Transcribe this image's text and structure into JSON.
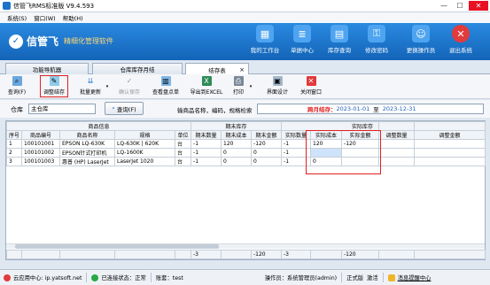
{
  "app": {
    "title": "信管飞RMS标准版 V9.4.593"
  },
  "window_controls": [
    "—",
    "☐",
    "✕"
  ],
  "menu": [
    "系统(S)",
    "窗口(W)",
    "帮助(H)"
  ],
  "brand": {
    "name": "信管飞",
    "slogan": "精细化管理软件"
  },
  "topnav": [
    {
      "label": "我的工作台",
      "color": "#4ea4f0",
      "glyph": "▦"
    },
    {
      "label": "单据中心",
      "color": "#4ea4f0",
      "glyph": "≣"
    },
    {
      "label": "库存查询",
      "color": "#4ea4f0",
      "glyph": "▤"
    },
    {
      "label": "修改密码",
      "color": "#4ea4f0",
      "glyph": "⚿"
    },
    {
      "label": "更换操作员",
      "color": "#4ea4f0",
      "glyph": "☺"
    },
    {
      "label": "退出系统",
      "color": "#e23b3b",
      "glyph": "✕"
    }
  ],
  "tabs": [
    "功能导航器",
    "仓库库存月结",
    "结存表"
  ],
  "tab_close": "×",
  "toolbar": {
    "query": "查询(F)",
    "adjust": "调整结存",
    "batch": "批量更新",
    "confirm": "确认保存",
    "check_slip": "查看盘点单",
    "export": "导出到EXCEL",
    "print": "打印",
    "design": "界面设计",
    "close": "关闭窗口"
  },
  "filter": {
    "warehouse_label": "仓库",
    "warehouse_value": "主仓库",
    "query_btn": "查询(F)",
    "search_placeholder": "输商品名称，编码，规格检索",
    "period_label": "跨月结存：",
    "period_from": "2023-01-01",
    "period_to_word": "至",
    "period_to": "2023-12-31"
  },
  "grid": {
    "group_headers": {
      "product": "商品信息",
      "period_end": "期末库存",
      "actual": "实际库存"
    },
    "columns": [
      "序号",
      "商品编号",
      "商品名称",
      "规格",
      "单位",
      "期末数量",
      "期末成本",
      "期末金额",
      "实际数量",
      "实际成本",
      "实际金额",
      "调整数量",
      "调整金额"
    ],
    "rows": [
      [
        "1",
        "100101001",
        "EPSON LQ-630K",
        "LQ-630K | 620K",
        "台",
        "-1",
        "120",
        "-120",
        "-1",
        "120",
        "-120",
        "",
        ""
      ],
      [
        "2",
        "100101002",
        "EPSON针式打印机",
        "LQ-1600K",
        "台",
        "-1",
        "0",
        "0",
        "-1",
        "",
        "",
        "",
        ""
      ],
      [
        "3",
        "100101003",
        "惠普 (HP) LaserJet",
        "LaserJet 1020",
        "台",
        "-1",
        "0",
        "0",
        "-1",
        "0",
        "",
        "",
        ""
      ]
    ],
    "totals": [
      "",
      "",
      "",
      "",
      "",
      "-3",
      "",
      "-120",
      "-3",
      "",
      "-120",
      "",
      ""
    ]
  },
  "status": {
    "cloud": "云应用中心: ip.yatsoft.net",
    "connect": "已连接状态：正常",
    "account": "账套：test",
    "operator": "操作员：系统管理员(admin)",
    "version": "正式版",
    "activate": "激活",
    "message": "消息提醒中心"
  }
}
